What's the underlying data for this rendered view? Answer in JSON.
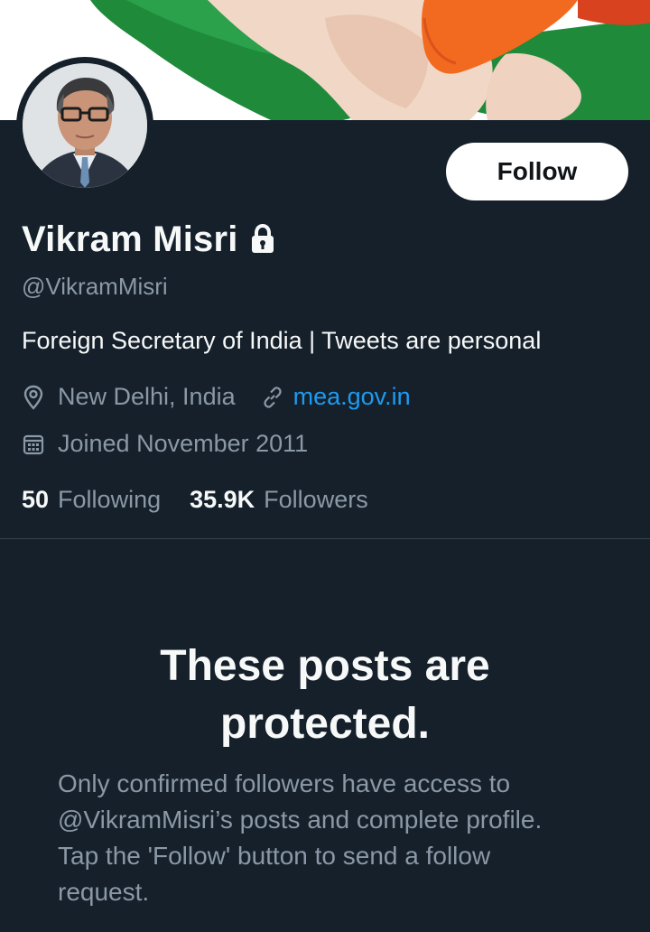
{
  "profile": {
    "display_name": "Vikram Misri",
    "handle": "@VikramMisri",
    "bio": "Foreign Secretary of India | Tweets are personal",
    "location": "New Delhi, India",
    "website": "mea.gov.in",
    "joined": "Joined November 2011",
    "protected_account": true
  },
  "actions": {
    "follow_label": "Follow"
  },
  "stats": {
    "following_count": "50",
    "following_label": "Following",
    "followers_count": "35.9K",
    "followers_label": "Followers"
  },
  "protected": {
    "title": "These posts are protected.",
    "message": "Only confirmed followers have access to @VikramMisri’s posts and complete profile. Tap the 'Follow' button to send a follow request."
  },
  "icons": {
    "lock": "lock-icon",
    "location": "location-pin-icon",
    "link": "link-icon",
    "calendar": "calendar-icon"
  },
  "colors": {
    "background": "#15202b",
    "primary_text": "#f7f9f9",
    "secondary_text": "#8b98a5",
    "link": "#1d9bf0",
    "divider": "#38444d",
    "follow_button_bg": "#ffffff"
  }
}
